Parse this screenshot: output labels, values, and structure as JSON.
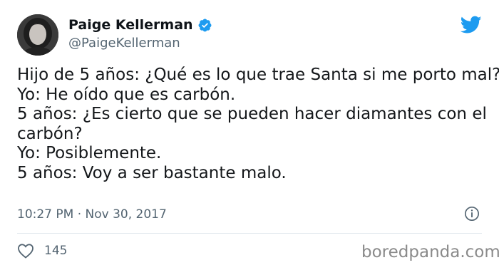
{
  "author": {
    "display_name": "Paige Kellerman",
    "handle": "@PaigeKellerman",
    "avatar_icon": "profile-photo",
    "verified_icon": "verified-badge-icon",
    "verified_color": "#1d9bf0"
  },
  "brand": {
    "icon": "twitter-bird-icon",
    "color": "#1d9bf0"
  },
  "tweet": {
    "lines": [
      "Hijo de 5 años: ¿Qué es lo que trae Santa si me porto mal?",
      "Yo: He oído que es carbón.",
      "5 años: ¿Es cierto que se pueden hacer diamantes con el",
      "carbón?",
      "Yo: Posiblemente.",
      "5 años: Voy a ser bastante malo."
    ],
    "timestamp": "10:27 PM · Nov 30, 2017"
  },
  "engagement": {
    "likes": "145",
    "heart_icon": "heart-icon",
    "info_icon": "info-icon"
  },
  "watermark": "boredpanda.com"
}
